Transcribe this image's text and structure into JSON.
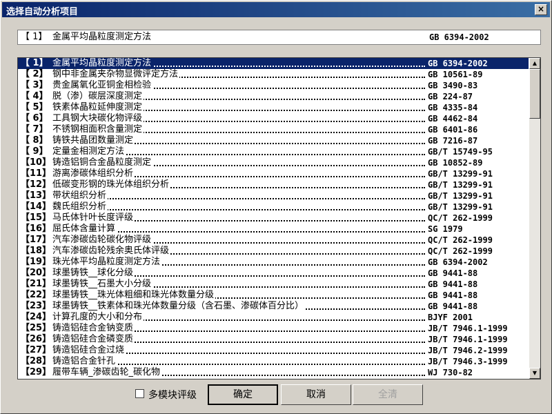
{
  "dialog": {
    "title": "选择自动分析项目",
    "close_glyph": "×"
  },
  "selected": {
    "index": "【 1】",
    "name": "金属平均晶粒度测定方法",
    "standard": "GB 6394-2002"
  },
  "items": [
    {
      "index": "【 1】",
      "name": "金属平均晶粒度测定方法",
      "standard": "GB 6394-2002",
      "selected": true
    },
    {
      "index": "【 2】",
      "name": "钢中非金属夹杂物显微评定方法",
      "standard": "GB 10561-89"
    },
    {
      "index": "【 3】",
      "name": "贵金属氧化亚铜金相检验",
      "standard": "GB 3490-83"
    },
    {
      "index": "【 4】",
      "name": "脱（渗）碳层深度测定",
      "standard": "GB 224-87"
    },
    {
      "index": "【 5】",
      "name": "铁素体晶粒延伸度测定",
      "standard": "GB 4335-84"
    },
    {
      "index": "【 6】",
      "name": "工具钢大块碳化物评级",
      "standard": "GB 4462-84"
    },
    {
      "index": "【 7】",
      "name": "不锈钢相面积含量测定",
      "standard": "GB 6401-86"
    },
    {
      "index": "【 8】",
      "name": "铸铁共晶团数量测定",
      "standard": "GB 7216-87"
    },
    {
      "index": "【 9】",
      "name": "定量金相测定方法",
      "standard": "GB/T 15749-95"
    },
    {
      "index": "【10】",
      "name": "铸造铝铜合金晶粒度测定",
      "standard": "GB 10852-89"
    },
    {
      "index": "【11】",
      "name": "游离渗碳体组织分析",
      "standard": "GB/T 13299-91"
    },
    {
      "index": "【12】",
      "name": "低碳变形钢的珠光体组织分析",
      "standard": "GB/T 13299-91"
    },
    {
      "index": "【13】",
      "name": "带状组织分析",
      "standard": "GB/T 13299-91"
    },
    {
      "index": "【14】",
      "name": "魏氏组织分析",
      "standard": "GB/T 13299-91"
    },
    {
      "index": "【15】",
      "name": "马氏体针叶长度评级",
      "standard": "QC/T 262-1999"
    },
    {
      "index": "【16】",
      "name": "屈氏体含量计算",
      "standard": "SG 1979"
    },
    {
      "index": "【17】",
      "name": "汽车渗碳齿轮碳化物评级",
      "standard": "QC/T 262-1999"
    },
    {
      "index": "【18】",
      "name": "汽车渗碳齿轮残余奥氏体评级",
      "standard": "QC/T 262-1999"
    },
    {
      "index": "【19】",
      "name": "珠光体平均晶粒度测定方法",
      "standard": "GB 6394-2002"
    },
    {
      "index": "【20】",
      "name": "球墨铸铁__球化分级",
      "standard": "GB 9441-88"
    },
    {
      "index": "【21】",
      "name": "球墨铸铁__石墨大小分级",
      "standard": "GB 9441-88"
    },
    {
      "index": "【22】",
      "name": "球墨铸铁__珠光体粗细和珠光体数量分级",
      "standard": "GB 9441-88"
    },
    {
      "index": "【23】",
      "name": "球墨铸铁__铁素体和珠光体数量分级（含石墨、渗碳体百分比）",
      "standard": "GB 9441-88"
    },
    {
      "index": "【24】",
      "name": "计算孔度的大小和分布",
      "standard": "BJYF 2001"
    },
    {
      "index": "【25】",
      "name": "铸造铝硅合金钠变质",
      "standard": "JB/T 7946.1-1999"
    },
    {
      "index": "【26】",
      "name": "铸造铝硅合金磷变质",
      "standard": "JB/T 7946.1-1999"
    },
    {
      "index": "【27】",
      "name": "铸造铝硅合金过烧",
      "standard": "JB/T 7946.2-1999"
    },
    {
      "index": "【28】",
      "name": "铸造铝合金针孔",
      "standard": "JB/T 7946.3-1999"
    },
    {
      "index": "【29】",
      "name": "履带车辆_渗碳齿轮_碳化物",
      "standard": "WJ 730-82"
    }
  ],
  "scrollbar": {
    "up_glyph": "▲",
    "down_glyph": "▼"
  },
  "footer": {
    "checkbox_label": "多模块评级",
    "checkbox_checked": false,
    "ok_label": "确定",
    "cancel_label": "取消",
    "clear_label": "全清"
  }
}
